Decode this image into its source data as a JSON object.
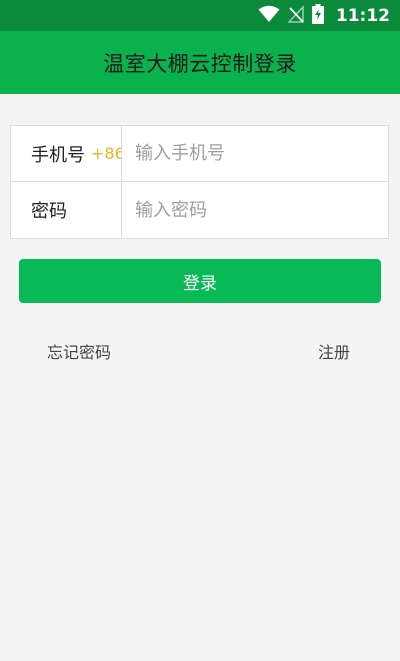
{
  "status_bar": {
    "time": "11:12",
    "icons": [
      "wifi-icon",
      "no-signal-icon",
      "battery-charging-icon"
    ]
  },
  "app_bar": {
    "title": "温室大棚云控制登录"
  },
  "login_form": {
    "phone_label": "手机号",
    "country_code": "+86",
    "phone_placeholder": "输入手机号",
    "password_label": "密码",
    "password_placeholder": "输入密码"
  },
  "actions": {
    "login_label": "登录",
    "forgot_password_label": "忘记密码",
    "register_label": "注册"
  },
  "colors": {
    "status_bar": "#0b8a3c",
    "app_bar": "#09b24d",
    "login_button": "#09b955",
    "country_code": "#e8b61c",
    "background": "#f4f4f4"
  }
}
